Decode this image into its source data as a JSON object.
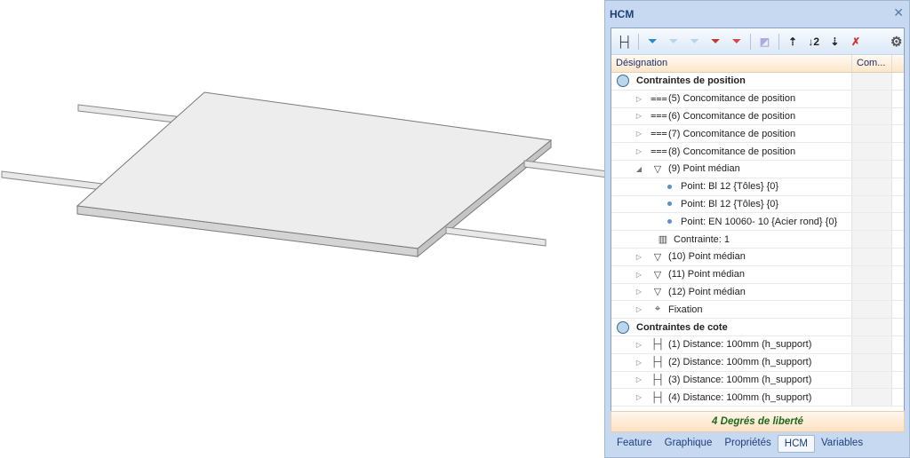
{
  "panel": {
    "title": "HCM"
  },
  "toolbar": {
    "icons": [
      "dimension-icon",
      "filter-icon",
      "filter-play-icon",
      "filter-square-icon",
      "filter-warning-icon",
      "filter-record-icon",
      "export-icon",
      "expand-list-icon",
      "sort-numbered-icon",
      "collapse-list-icon",
      "sort-clear-icon",
      "gear-icon"
    ]
  },
  "table": {
    "col_designation": "Désignation",
    "col_comment": "Com..."
  },
  "rows": [
    {
      "level": 0,
      "label": "Contraintes de position",
      "kind": "group"
    },
    {
      "level": 1,
      "label": "(5) Concomitance de position",
      "kind": "conc",
      "exp": "closed"
    },
    {
      "level": 1,
      "label": "(6) Concomitance de position",
      "kind": "conc",
      "exp": "closed"
    },
    {
      "level": 1,
      "label": "(7) Concomitance de position",
      "kind": "conc",
      "exp": "closed"
    },
    {
      "level": 1,
      "label": "(8) Concomitance de position",
      "kind": "conc",
      "exp": "closed"
    },
    {
      "level": 1,
      "label": "(9) Point médian",
      "kind": "mid",
      "exp": "open"
    },
    {
      "level": 2,
      "label": "Point: Bl 12 {Tôles} {0}",
      "kind": "point"
    },
    {
      "level": 2,
      "label": "Point: Bl 12 {Tôles} {0}",
      "kind": "point"
    },
    {
      "level": 2,
      "label": "Point: EN 10060- 10 {Acier rond} {0}",
      "kind": "point"
    },
    {
      "level": 2,
      "label": "Contrainte: 1",
      "kind": "constraint"
    },
    {
      "level": 1,
      "label": "(10) Point médian",
      "kind": "mid",
      "exp": "closed"
    },
    {
      "level": 1,
      "label": "(11) Point médian",
      "kind": "mid",
      "exp": "closed"
    },
    {
      "level": 1,
      "label": "(12) Point médian",
      "kind": "mid",
      "exp": "closed"
    },
    {
      "level": 1,
      "label": "Fixation",
      "kind": "fix",
      "exp": "closed"
    },
    {
      "level": 0,
      "label": "Contraintes de cote",
      "kind": "group"
    },
    {
      "level": 1,
      "label": "(1) Distance: 100mm (h_support)",
      "kind": "dist",
      "exp": "closed"
    },
    {
      "level": 1,
      "label": "(2) Distance: 100mm (h_support)",
      "kind": "dist",
      "exp": "closed"
    },
    {
      "level": 1,
      "label": "(3) Distance: 100mm (h_support)",
      "kind": "dist",
      "exp": "closed"
    },
    {
      "level": 1,
      "label": "(4) Distance: 100mm (h_support)",
      "kind": "dist",
      "exp": "closed"
    }
  ],
  "status": "4 Degrés de liberté",
  "tabs": [
    {
      "label": "Feature"
    },
    {
      "label": "Graphique"
    },
    {
      "label": "Propriétés"
    },
    {
      "label": "HCM",
      "active": true
    },
    {
      "label": "Variables"
    }
  ]
}
